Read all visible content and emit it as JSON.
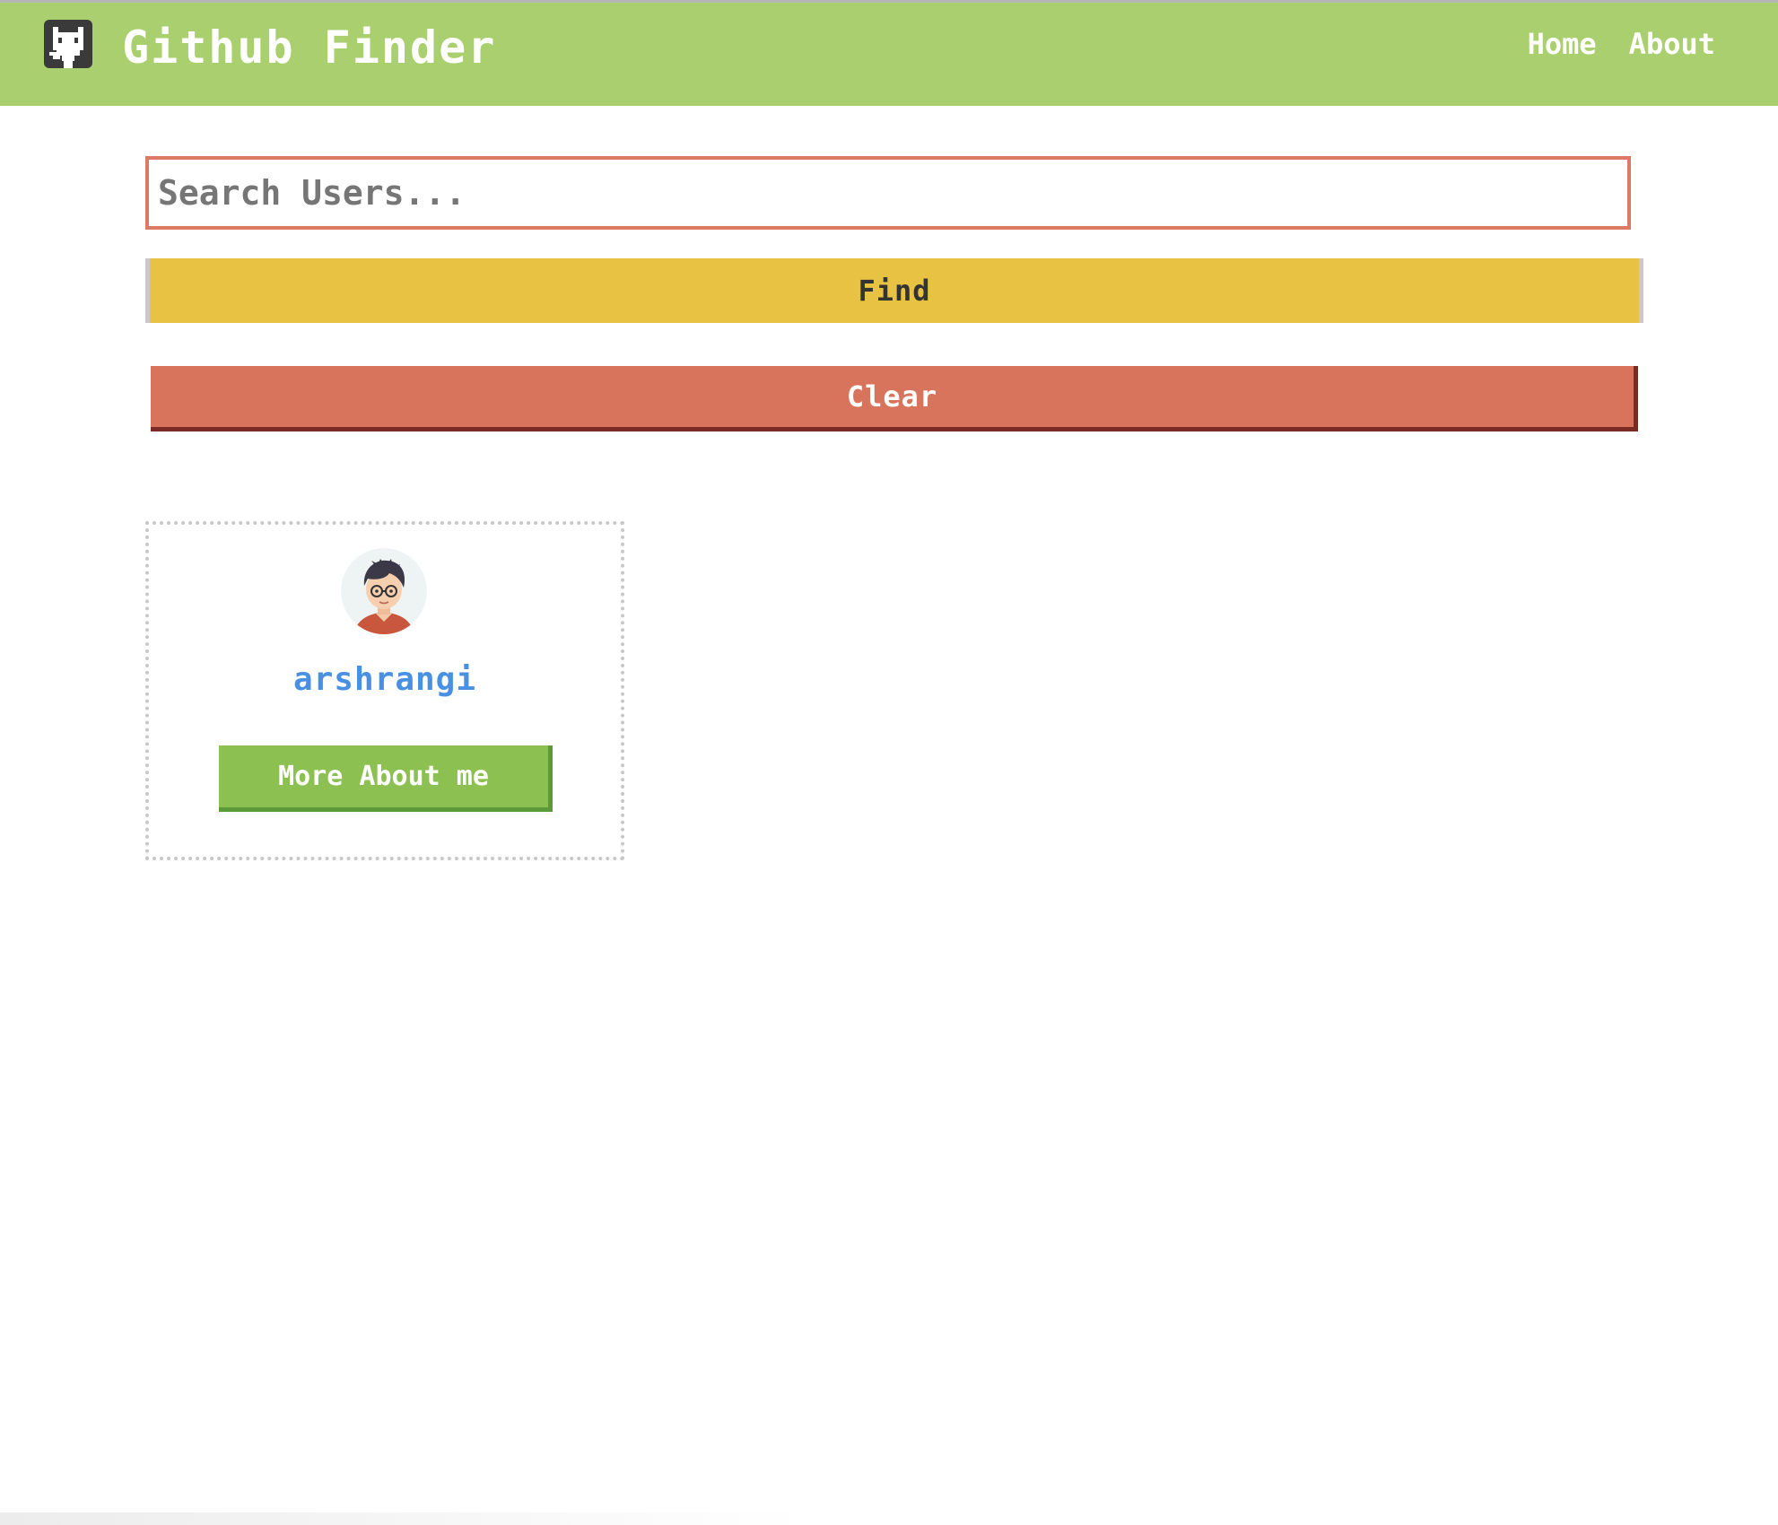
{
  "navbar": {
    "logo_icon": "github-icon",
    "title": "Github Finder",
    "links": [
      {
        "label": "Home"
      },
      {
        "label": "About"
      }
    ],
    "background_color": "#a9cf6e"
  },
  "search": {
    "placeholder": "Search Users...",
    "value": "",
    "find_label": "Find",
    "clear_label": "Clear"
  },
  "users": [
    {
      "login": "arshrangi",
      "avatar_icon": "user-avatar",
      "more_label": "More About me"
    }
  ],
  "colors": {
    "accent_green": "#8cc152",
    "find_yellow": "#e8c242",
    "clear_red": "#d9745c",
    "link_blue": "#4a90e2"
  }
}
